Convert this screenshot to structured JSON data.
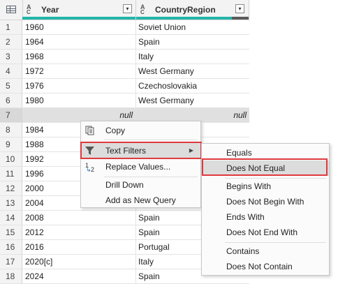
{
  "columns": [
    {
      "type_icon_top": "A",
      "type_icon_sub": "B",
      "type_icon_bot": "C",
      "name": "Year",
      "dropdown": "▾"
    },
    {
      "type_icon_top": "A",
      "type_icon_sub": "B",
      "type_icon_bot": "C",
      "name": "CountryRegion",
      "dropdown": "▾"
    }
  ],
  "rows": [
    {
      "n": "1",
      "year": "1960",
      "country": "Soviet Union"
    },
    {
      "n": "2",
      "year": "1964",
      "country": "Spain"
    },
    {
      "n": "3",
      "year": "1968",
      "country": "Italy"
    },
    {
      "n": "4",
      "year": "1972",
      "country": "West Germany"
    },
    {
      "n": "5",
      "year": "1976",
      "country": "Czechoslovakia"
    },
    {
      "n": "6",
      "year": "1980",
      "country": "West Germany"
    },
    {
      "n": "7",
      "year": "null",
      "country": "null"
    },
    {
      "n": "8",
      "year": "1984",
      "country": ""
    },
    {
      "n": "9",
      "year": "1988",
      "country": ""
    },
    {
      "n": "10",
      "year": "1992",
      "country": ""
    },
    {
      "n": "11",
      "year": "1996",
      "country": ""
    },
    {
      "n": "12",
      "year": "2000",
      "country": ""
    },
    {
      "n": "13",
      "year": "2004",
      "country": ""
    },
    {
      "n": "14",
      "year": "2008",
      "country": "Spain"
    },
    {
      "n": "15",
      "year": "2012",
      "country": "Spain"
    },
    {
      "n": "16",
      "year": "2016",
      "country": "Portugal"
    },
    {
      "n": "17",
      "year": "2020[c]",
      "country": "Italy"
    },
    {
      "n": "18",
      "year": "2024",
      "country": "Spain"
    }
  ],
  "context_menu": {
    "copy": "Copy",
    "text_filters": "Text Filters",
    "replace_values": "Replace Values...",
    "replace_icon_top": "1",
    "replace_icon_bot": "2",
    "drill_down": "Drill Down",
    "add_as_new_query": "Add as New Query",
    "submenu_arrow": "▶"
  },
  "submenu": {
    "equals": "Equals",
    "does_not_equal": "Does Not Equal",
    "begins_with": "Begins With",
    "does_not_begin_with": "Does Not Begin With",
    "ends_with": "Ends With",
    "does_not_end_with": "Does Not End With",
    "contains": "Contains",
    "does_not_contain": "Does Not Contain"
  },
  "colors": {
    "quality_bar_teal": "#23b5a9",
    "quality_bar_dark": "#5a5a5a",
    "highlight_border": "#e0393e"
  }
}
